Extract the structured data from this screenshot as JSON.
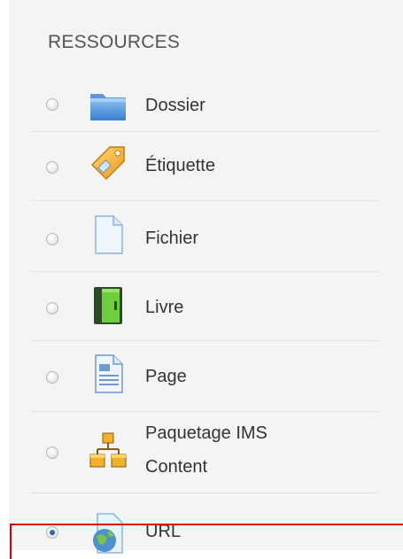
{
  "section": {
    "title": "RESSOURCES"
  },
  "items": [
    {
      "label": "Dossier",
      "icon": "folder-icon",
      "checked": false
    },
    {
      "label": "Étiquette",
      "icon": "tag-icon",
      "checked": false
    },
    {
      "label": "Fichier",
      "icon": "file-icon",
      "checked": false
    },
    {
      "label": "Livre",
      "icon": "book-icon",
      "checked": false
    },
    {
      "label": "Page",
      "icon": "page-icon",
      "checked": false
    },
    {
      "label_line1": "Paquetage IMS",
      "label_line2": "Content",
      "icon": "ims-package-icon",
      "checked": false
    },
    {
      "label": "URL",
      "icon": "url-globe-icon",
      "checked": true
    }
  ],
  "colors": {
    "highlight": "#e00000",
    "panel": "#f4f4f4"
  }
}
